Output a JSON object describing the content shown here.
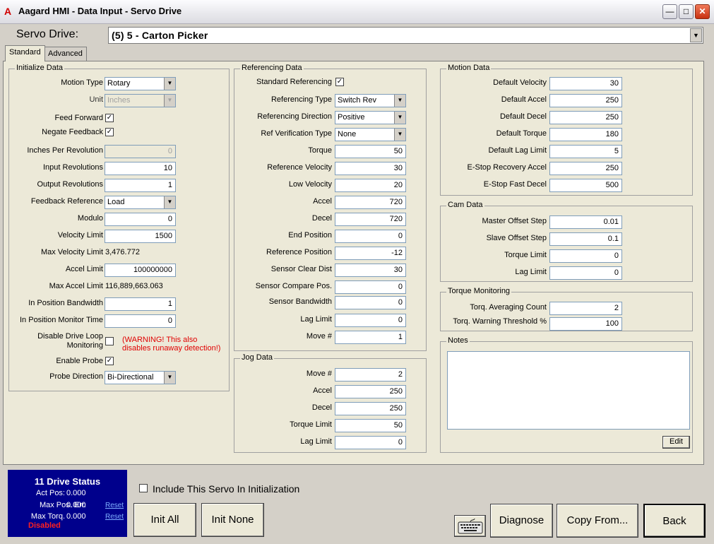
{
  "window": {
    "title": "Aagard HMI - Data Input - Servo Drive",
    "logo": "A"
  },
  "header": {
    "servo_label": "Servo Drive:",
    "servo_value": "(5) 5 - Carton Picker"
  },
  "tabs": {
    "standard": "Standard",
    "advanced": "Advanced"
  },
  "initialize": {
    "title": "Initialize Data",
    "motion_type_label": "Motion Type",
    "motion_type": "Rotary",
    "unit_label": "Unit",
    "unit": "Inches",
    "feed_forward_label": "Feed Forward",
    "feed_forward": true,
    "negate_feedback_label": "Negate Feedback",
    "negate_feedback": true,
    "inches_per_rev_label": "Inches Per Revolution",
    "inches_per_rev": "0",
    "input_rev_label": "Input Revolutions",
    "input_rev": "10",
    "output_rev_label": "Output Revolutions",
    "output_rev": "1",
    "feedback_ref_label": "Feedback Reference",
    "feedback_ref": "Load",
    "modulo_label": "Modulo",
    "modulo": "0",
    "velocity_limit_label": "Velocity Limit",
    "velocity_limit": "1500",
    "max_velocity_label": "Max Velocity Limit",
    "max_velocity": "3,476.772",
    "accel_limit_label": "Accel Limit",
    "accel_limit": "100000000",
    "max_accel_label": "Max Accel Limit",
    "max_accel": "116,889,663.063",
    "in_pos_bw_label": "In Position Bandwidth",
    "in_pos_bw": "1",
    "in_pos_time_label": "In Position Monitor Time",
    "in_pos_time": "0",
    "disable_loop_label1": "Disable Drive Loop",
    "disable_loop_label2": "Monitoring",
    "disable_loop": false,
    "warning1": "(WARNING! This also",
    "warning2": "disables runaway detection!)",
    "enable_probe_label": "Enable Probe",
    "enable_probe": true,
    "probe_dir_label": "Probe Direction",
    "probe_dir": "Bi-Directional"
  },
  "referencing": {
    "title": "Referencing Data",
    "standard_ref_label": "Standard Referencing",
    "standard_ref": true,
    "ref_type_label": "Referencing Type",
    "ref_type": "Switch Rev",
    "ref_dir_label": "Referencing Direction",
    "ref_dir": "Positive",
    "ref_verif_label": "Ref Verification Type",
    "ref_verif": "None",
    "torque_label": "Torque",
    "torque": "50",
    "ref_vel_label": "Reference Velocity",
    "ref_vel": "30",
    "low_vel_label": "Low Velocity",
    "low_vel": "20",
    "accel_label": "Accel",
    "accel": "720",
    "decel_label": "Decel",
    "decel": "720",
    "end_pos_label": "End Position",
    "end_pos": "0",
    "ref_pos_label": "Reference Position",
    "ref_pos": "-12",
    "sensor_clear_label": "Sensor Clear Dist",
    "sensor_clear": "30",
    "sensor_compare_label": "Sensor Compare Pos.",
    "sensor_compare": "0",
    "sensor_bw_label": "Sensor Bandwidth",
    "sensor_bw": "0",
    "lag_limit_label": "Lag Limit",
    "lag_limit": "0",
    "move_label": "Move #",
    "move": "1"
  },
  "jog": {
    "title": "Jog Data",
    "move_label": "Move #",
    "move": "2",
    "accel_label": "Accel",
    "accel": "250",
    "decel_label": "Decel",
    "decel": "250",
    "torque_limit_label": "Torque Limit",
    "torque_limit": "50",
    "lag_limit_label": "Lag Limit",
    "lag_limit": "0"
  },
  "motion": {
    "title": "Motion Data",
    "def_vel_label": "Default Velocity",
    "def_vel": "30",
    "def_accel_label": "Default Accel",
    "def_accel": "250",
    "def_decel_label": "Default Decel",
    "def_decel": "250",
    "def_torque_label": "Default Torque",
    "def_torque": "180",
    "def_lag_label": "Default Lag Limit",
    "def_lag": "5",
    "estop_rec_label": "E-Stop Recovery Accel",
    "estop_rec": "250",
    "estop_fast_label": "E-Stop Fast Decel",
    "estop_fast": "500"
  },
  "cam": {
    "title": "Cam Data",
    "master_label": "Master Offset Step",
    "master": "0.01",
    "slave_label": "Slave Offset Step",
    "slave": "0.1",
    "torque_label": "Torque Limit",
    "torque": "0",
    "lag_label": "Lag Limit",
    "lag": "0"
  },
  "torque_mon": {
    "title": "Torque Monitoring",
    "avg_label": "Torq. Averaging Count",
    "avg": "2",
    "warn_label": "Torq. Warning Threshold %",
    "warn": "100"
  },
  "notes": {
    "title": "Notes",
    "edit": "Edit"
  },
  "status": {
    "title": "11 Drive Status",
    "act_pos_label": "Act Pos:",
    "act_pos": "0.000",
    "max_err_label": "Max Pos. Err.",
    "max_err": "0.000",
    "max_torq_label": "Max Torq.",
    "max_torq": "0.000",
    "reset1": "Reset",
    "reset2": "Reset",
    "state": "Disabled"
  },
  "footer": {
    "include_label": "Include This Servo In Initialization",
    "include": false,
    "init_all": "Init All",
    "init_none": "Init None",
    "diagnose": "Diagnose",
    "copy_from": "Copy From...",
    "back": "Back"
  },
  "icons": [
    "app-logo-icon",
    "minimize-icon",
    "maximize-icon",
    "close-icon",
    "dropdown-arrow-icon",
    "checkmark-icon",
    "keyboard-icon"
  ]
}
